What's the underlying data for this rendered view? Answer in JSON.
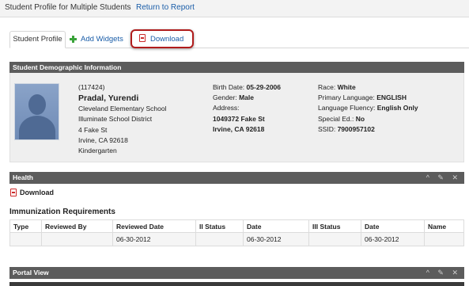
{
  "topbar": {
    "title": "Student Profile for Multiple Students",
    "return_link": "Return to Report"
  },
  "tabs": {
    "active": "Student Profile",
    "add_widgets": "Add Widgets",
    "download": "Download"
  },
  "demographics": {
    "header": "Student Demographic Information",
    "id": "(117424)",
    "name": "Pradal, Yurendi",
    "school": "Cleveland Elementary School",
    "district": "Illuminate School District",
    "street": "4 Fake St",
    "city": "Irvine, CA 92618",
    "grade": "Kindergarten",
    "birth_label": "Birth Date:",
    "birth": "05-29-2006",
    "gender_label": "Gender:",
    "gender": "Male",
    "address_label": "Address:",
    "address1": "1049372 Fake St",
    "address2": "Irvine, CA 92618",
    "race_label": "Race:",
    "race": "White",
    "language_label": "Primary Language:",
    "language": "ENGLISH",
    "fluency_label": "Language Fluency:",
    "fluency": "English Only",
    "special_label": "Special Ed.:",
    "special": "No",
    "ssid_label": "SSID:",
    "ssid": "7900957102"
  },
  "health": {
    "header": "Health",
    "download": "Download",
    "imm_title": "Immunization Requirements",
    "columns": [
      "Type",
      "Reviewed By",
      "Reviewed Date",
      "II Status",
      "Date",
      "III Status",
      "Date",
      "Name"
    ],
    "row": [
      "",
      "",
      "06-30-2012",
      "",
      "06-30-2012",
      "",
      "06-30-2012",
      ""
    ]
  },
  "portal": {
    "header": "Portal View"
  },
  "panel_controls": "^ ✎ ✕",
  "colors": {
    "panel_header": "#5c5c5c",
    "link": "#1a5da8",
    "highlight": "#b01c1c",
    "plus": "#3aa33a"
  }
}
